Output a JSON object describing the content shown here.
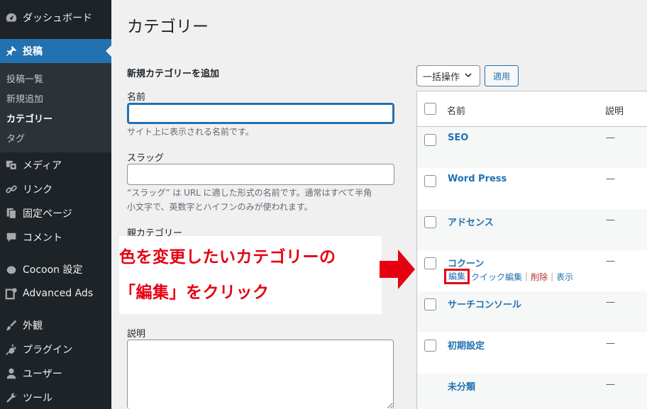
{
  "sidebar": {
    "dashboard": "ダッシュボード",
    "posts": "投稿",
    "submenu": [
      "投稿一覧",
      "新規追加",
      "カテゴリー",
      "タグ"
    ],
    "media": "メディア",
    "links": "リンク",
    "pages": "固定ページ",
    "comments": "コメント",
    "cocoon": "Cocoon 設定",
    "advanced_ads": "Advanced Ads",
    "appearance": "外観",
    "plugins": "プラグイン",
    "users": "ユーザー",
    "tools": "ツール"
  },
  "page": {
    "title": "カテゴリー"
  },
  "form": {
    "title": "新規カテゴリーを追加",
    "name_label": "名前",
    "name_value": "",
    "name_desc": "サイト上に表示される名前です。",
    "slug_label": "スラッグ",
    "slug_value": "",
    "slug_desc_1": "“スラッグ” は URL に適した形式の名前です。通常はすべて半角",
    "slug_desc_2": "小文字で、英数字とハイフンのみが使われます。",
    "parent_label": "親カテゴリー",
    "description_label": "説明"
  },
  "annotation": {
    "line1": "色を変更したいカテゴリーの",
    "line2": "「編集」をクリック",
    "color": "#e60012"
  },
  "table": {
    "bulk_action": "一括操作",
    "apply": "適用",
    "col_name": "名前",
    "col_desc": "説明",
    "rows": [
      {
        "name": "SEO",
        "desc": "—"
      },
      {
        "name": "Word Press",
        "desc": "—"
      },
      {
        "name": "アドセンス",
        "desc": "—"
      },
      {
        "name": "コクーン",
        "desc": "—"
      },
      {
        "name": "サーチコンソール",
        "desc": "—"
      },
      {
        "name": "初期設定",
        "desc": "—"
      },
      {
        "name": "未分類",
        "desc": "—"
      }
    ],
    "row_actions": {
      "edit": "編集",
      "quick_edit": "クイック編集",
      "delete": "削除",
      "view": "表示",
      "sep": "|"
    }
  },
  "colors": {
    "sidebar_bg": "#1d2327",
    "accent": "#2271b1",
    "annotation_red": "#e60012"
  }
}
